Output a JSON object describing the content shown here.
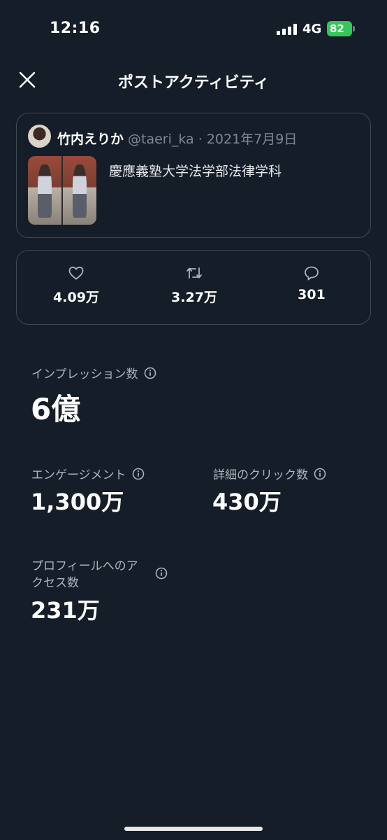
{
  "status_bar": {
    "time": "12:16",
    "network": "4G",
    "battery": "82"
  },
  "header": {
    "title": "ポストアクティビティ"
  },
  "post": {
    "author_name": "竹内えりか",
    "author_meta": "@taeri_ka · 2021年7月9日",
    "text": "慶應義塾大学法学部法律学科"
  },
  "engagement": {
    "likes": "4.09万",
    "reposts": "3.27万",
    "replies": "301"
  },
  "metrics": {
    "impressions": {
      "label": "インプレッション数",
      "value": "6億"
    },
    "engagements": {
      "label": "エンゲージメント",
      "value": "1,300万"
    },
    "detail_clicks": {
      "label": "詳細のクリック数",
      "value": "430万"
    },
    "profile_visits": {
      "label_line1": "プロフィールへのア",
      "label_line2": "クセス数",
      "value": "231万"
    }
  },
  "colors": {
    "background": "#151d28",
    "card_border": "#3f4953",
    "muted_text": "#7d8a96",
    "battery": "#34c759"
  },
  "icons": [
    "close-icon",
    "heart-icon",
    "repost-icon",
    "reply-icon",
    "info-icon"
  ]
}
